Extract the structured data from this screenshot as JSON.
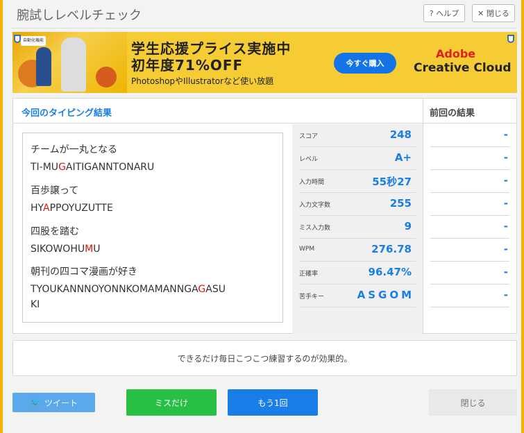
{
  "window": {
    "title": "腕試しレベルチェック"
  },
  "header": {
    "help_icon": "question-icon",
    "help_label": "? ヘルプ",
    "close_icon": "close-icon",
    "close_label": "✕ 閉じる"
  },
  "banner": {
    "headline_line1": "学生応援プライス実施中",
    "headline_line2": "初年度71%OFF",
    "subline": "PhotoshopやIllustratorなど使い放題",
    "cta": "今すぐ購入",
    "brand_line1": "Adobe",
    "brand_line2": "Creative Cloud",
    "sticker": "自動化機能"
  },
  "results": {
    "current_title": "今回のタイピング結果",
    "previous_title": "前回の結果",
    "words": [
      {
        "jp": "チームが一丸となる",
        "romaji_before": "TI-MU",
        "romaji_miss": "G",
        "romaji_after": "AITIGANNTONARU"
      },
      {
        "jp": "百歩譲って",
        "romaji_before": "HY",
        "romaji_miss": "A",
        "romaji_after": "PPOYUZUTTE"
      },
      {
        "jp": "四股を踏む",
        "romaji_before": "SIKOWOHU",
        "romaji_miss": "M",
        "romaji_after": "U"
      },
      {
        "jp": "朝刊の四コマ漫画が好き",
        "romaji_before": "TYOUKANNNOYONNKOMAMANNGA",
        "romaji_miss": "G",
        "romaji_after": "ASU",
        "romaji_line2": "KI"
      }
    ],
    "stats": [
      {
        "label": "スコア",
        "value": "248",
        "previous": "-"
      },
      {
        "label": "レベル",
        "value": "A+",
        "previous": "-"
      },
      {
        "label": "入力時間",
        "value": "55秒27",
        "previous": "-"
      },
      {
        "label": "入力文字数",
        "value": "255",
        "previous": "-"
      },
      {
        "label": "ミス入力数",
        "value": "9",
        "previous": "-"
      },
      {
        "label": "WPM",
        "value": "276.78",
        "previous": "-"
      },
      {
        "label": "正確率",
        "value": "96.47%",
        "previous": "-"
      },
      {
        "label": "苦手キー",
        "value": "ASGOM",
        "previous": "-"
      }
    ]
  },
  "advice": "できるだけ毎日こつこつ練習するのが効果的。",
  "buttons": {
    "tweet_icon": "twitter-bird-icon",
    "tweet": "ツイート",
    "miss_only": "ミスだけ",
    "retry": "もう1回",
    "close": "閉じる"
  },
  "colors": {
    "accent_blue": "#1a7ee8",
    "miss_red": "#e01010",
    "green": "#27c044",
    "twitter": "#5aa9ea",
    "banner_yellow": "#f5cc33"
  }
}
